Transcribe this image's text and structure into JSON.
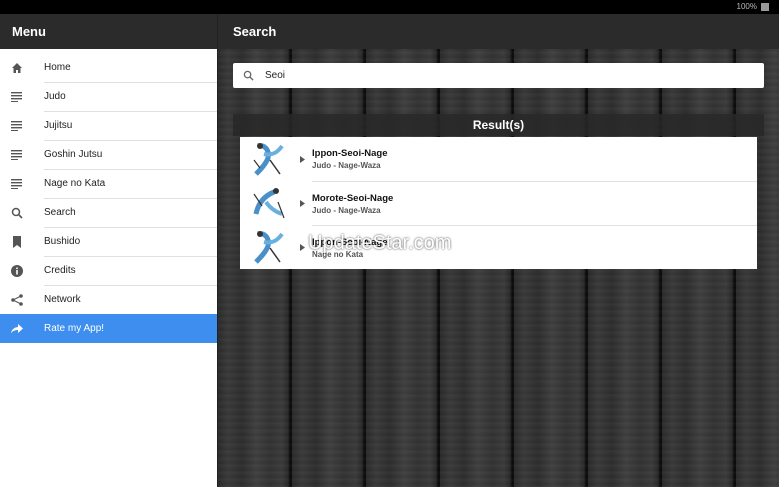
{
  "statusbar": {
    "battery": "100%"
  },
  "sidebar": {
    "title": "Menu",
    "items": [
      {
        "label": "Home",
        "icon": "home-icon"
      },
      {
        "label": "Judo",
        "icon": "list-icon"
      },
      {
        "label": "Jujitsu",
        "icon": "list-icon"
      },
      {
        "label": "Goshin Jutsu",
        "icon": "list-icon"
      },
      {
        "label": "Nage no Kata",
        "icon": "list-icon"
      },
      {
        "label": "Search",
        "icon": "search-icon"
      },
      {
        "label": "Bushido",
        "icon": "bookmark-icon"
      },
      {
        "label": "Credits",
        "icon": "info-icon"
      },
      {
        "label": "Network",
        "icon": "share-icon"
      },
      {
        "label": "Rate my App!",
        "icon": "forward-icon",
        "active": true
      }
    ]
  },
  "main": {
    "title": "Search",
    "search": {
      "value": "Seoi",
      "icon": "search-icon"
    },
    "results_heading": "Result(s)",
    "results": [
      {
        "title": "Ippon-Seoi-Nage",
        "subtitle": "Judo - Nage-Waza"
      },
      {
        "title": "Morote-Seoi-Nage",
        "subtitle": "Judo - Nage-Waza"
      },
      {
        "title": "Ippon-Seoi-Nage",
        "subtitle": "Nage no Kata"
      }
    ]
  },
  "watermark": "UpdateStar.com",
  "colors": {
    "accent": "#3d8eef",
    "header": "#2b2b2b"
  }
}
